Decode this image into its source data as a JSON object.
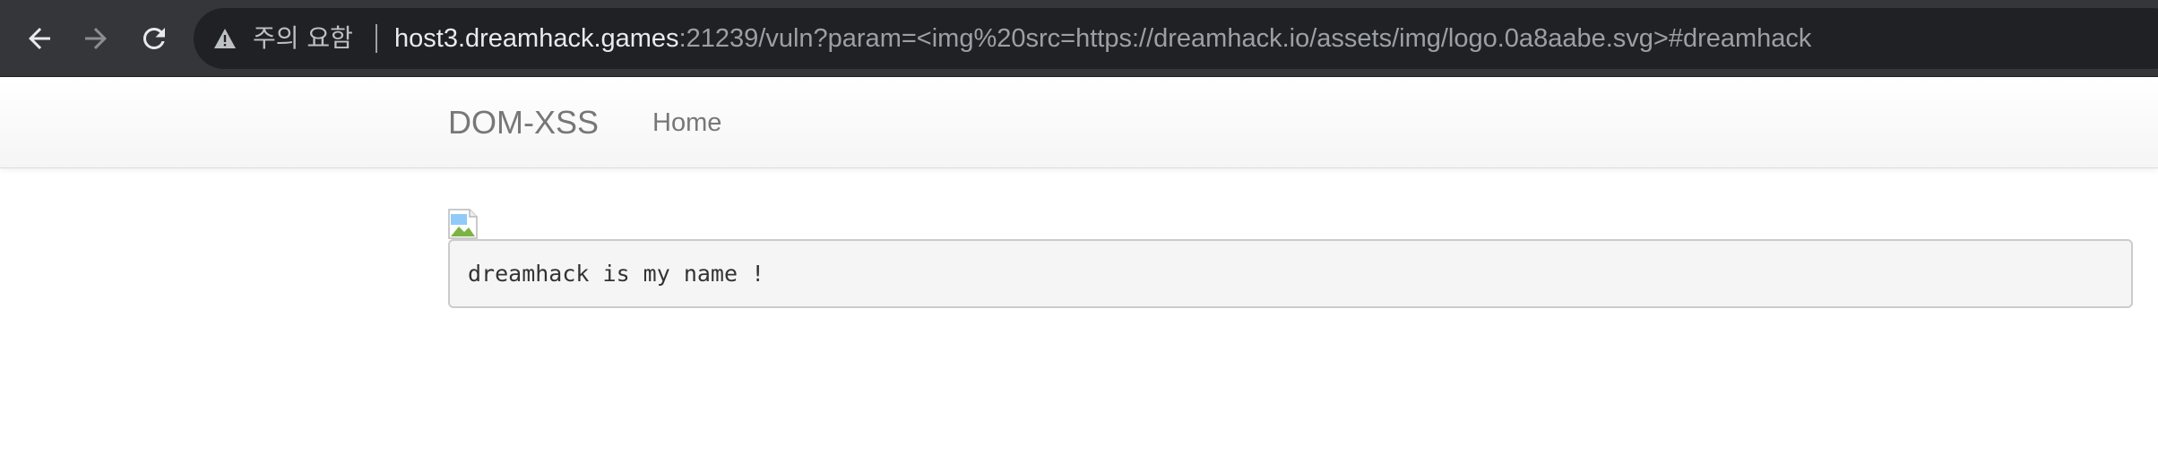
{
  "browser": {
    "back_icon": "arrow-left-icon",
    "forward_icon": "arrow-right-icon",
    "reload_icon": "reload-icon",
    "security_icon": "warning-triangle-icon",
    "security_text": "주의 요함",
    "url_host": "host3.dreamhack.games",
    "url_rest": ":21239/vuln?param=<img%20src=https://dreamhack.io/assets/img/logo.0a8aabe.svg>#dreamhack"
  },
  "navbar": {
    "brand": "DOM-XSS",
    "links": [
      {
        "label": "Home"
      }
    ]
  },
  "content": {
    "image_icon": "broken-image-icon",
    "message": "dreamhack is my name !"
  },
  "colors": {
    "toolbar_bg": "#35363a",
    "omnibox_bg": "#202124",
    "host_text": "#e8eaed",
    "url_text": "#9aa0a6",
    "nav_text": "#777777",
    "pre_bg": "#f5f5f5",
    "pre_border": "#cccccc"
  }
}
